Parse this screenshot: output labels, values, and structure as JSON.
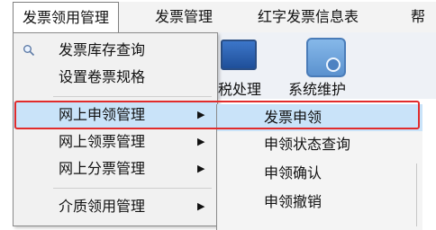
{
  "menubar": {
    "items": [
      {
        "label": "发票领用管理"
      },
      {
        "label": "发票管理"
      },
      {
        "label": "红字发票信息表"
      },
      {
        "label": "帮"
      }
    ]
  },
  "toolbar": {
    "labels": [
      "税处理",
      "系统维护"
    ],
    "icons": [
      "monitor-icon",
      "folder-settings-icon"
    ]
  },
  "dropdown": {
    "items": [
      {
        "label": "发票库存查询",
        "icon": "magnifier-icon"
      },
      {
        "label": "设置卷票规格"
      },
      {
        "label": "网上申领管理",
        "has_submenu": true
      },
      {
        "label": "网上领票管理",
        "has_submenu": true
      },
      {
        "label": "网上分票管理",
        "has_submenu": true
      },
      {
        "label": "介质领用管理",
        "has_submenu": true
      }
    ],
    "arrow_symbol": "▶"
  },
  "submenu": {
    "items": [
      {
        "label": "发票申领"
      },
      {
        "label": "申领状态查询"
      },
      {
        "label": "申领确认"
      },
      {
        "label": "申领撤销"
      }
    ]
  },
  "colors": {
    "highlight": "#c9e3f9",
    "annotation_red": "#e12c2c"
  }
}
